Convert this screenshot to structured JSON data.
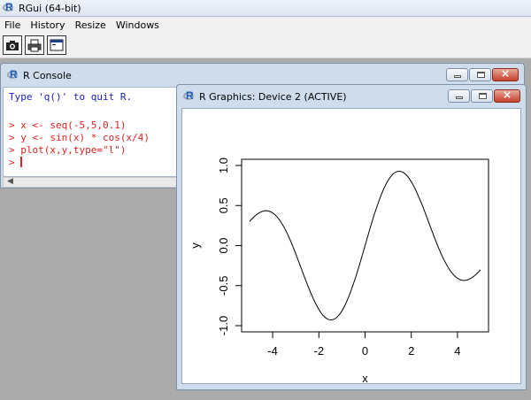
{
  "app": {
    "title": "RGui (64-bit)"
  },
  "menu": [
    {
      "label": "File"
    },
    {
      "label": "History"
    },
    {
      "label": "Resize"
    },
    {
      "label": "Windows"
    }
  ],
  "toolbar": {
    "buttons": [
      "camera-icon",
      "printer-icon",
      "window-icon"
    ]
  },
  "console": {
    "title": "R Console",
    "lines": [
      {
        "text": "Type 'q()' to quit R.",
        "color": "#1c1cb4"
      },
      {
        "text": ""
      },
      {
        "text": "> x <- seq(-5,5,0.1)",
        "color": "#e12020"
      },
      {
        "text": "> y <- sin(x) * cos(x/4)",
        "color": "#e12020"
      },
      {
        "text": "> plot(x,y,type=\"l\")",
        "color": "#e12020"
      },
      {
        "text": "> ",
        "color": "#e12020"
      }
    ]
  },
  "graphics": {
    "title": "R Graphics: Device 2 (ACTIVE)"
  },
  "chart_data": {
    "type": "line",
    "xlabel": "x",
    "ylabel": "y",
    "xlim": [
      -5,
      5
    ],
    "ylim": [
      -1.0,
      1.0
    ],
    "xticks": [
      -4,
      -2,
      0,
      2,
      4
    ],
    "yticks": [
      -1.0,
      -0.5,
      0.0,
      0.5,
      1.0
    ],
    "xtick_labels": [
      "-4",
      "-2",
      "0",
      "2",
      "4"
    ],
    "ytick_labels": [
      "-1.0",
      "-0.5",
      "0.0",
      "0.5",
      "1.0"
    ],
    "series": [
      {
        "function": "sin(x) * cos(x/4)",
        "x_from": -5,
        "x_to": 5,
        "x_step": 0.1
      }
    ]
  }
}
